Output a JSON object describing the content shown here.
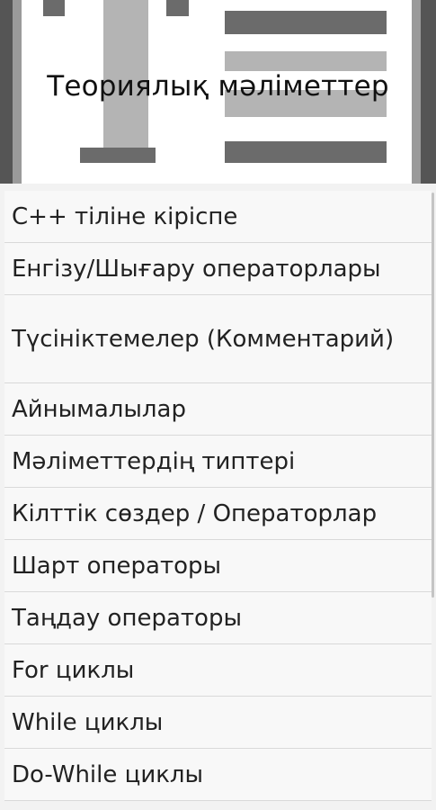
{
  "header": {
    "title": "Теориялық мәліметтер",
    "icon": "text-format-icon"
  },
  "topics": [
    {
      "label": "С++ тіліне кіріспе"
    },
    {
      "label": "Енгізу/Шығару операторлары"
    },
    {
      "label": "Түсініктемелер (Комментарий)"
    },
    {
      "label": "Айнымалылар"
    },
    {
      "label": "Мәліметтердің типтері"
    },
    {
      "label": "Кілттік сөздер / Операторлар"
    },
    {
      "label": "Шарт операторы"
    },
    {
      "label": "Таңдау операторы"
    },
    {
      "label": "For циклы"
    },
    {
      "label": "While циклы"
    },
    {
      "label": "Do-While циклы"
    }
  ],
  "colors": {
    "background": "#f2f2f2",
    "item_background": "#f8f8f8",
    "divider": "#d9d9d9",
    "text": "#222222"
  }
}
